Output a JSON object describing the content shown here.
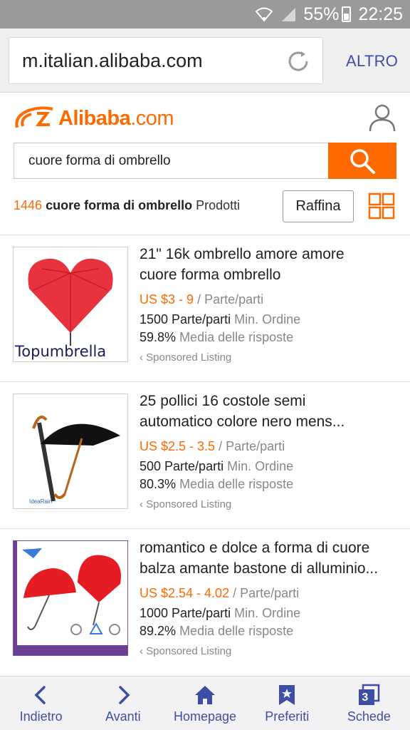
{
  "status_bar": {
    "battery": "55%",
    "time": "22:25"
  },
  "browser": {
    "url": "m.italian.alibaba.com",
    "menu_label": "ALTRO"
  },
  "site": {
    "logo_main": "Alibaba",
    "logo_suffix": ".com",
    "brand_color": "#ff6a00"
  },
  "search": {
    "query": "cuore forma di ombrello"
  },
  "results": {
    "count": "1446",
    "query": "cuore forma di ombrello",
    "suffix": "Prodotti",
    "refine_label": "Raffina"
  },
  "products": [
    {
      "title_line1": "21\" 16k ombrello amore amore",
      "title_line2": "cuore forma ombrello",
      "price": "US $3 - 9",
      "price_unit": "/ Parte/parti",
      "min_qty": "1500 Parte/parti",
      "min_label": "Min. Ordine",
      "rate": "59.8%",
      "rate_label": "Media delle risposte",
      "sponsored": "Sponsored Listing",
      "thumb_caption": "Topumbrella"
    },
    {
      "title_line1": "25 pollici 16 costole semi",
      "title_line2": "automatico colore nero mens...",
      "price": "US $2.5 - 3.5",
      "price_unit": "/ Parte/parti",
      "min_qty": "500 Parte/parti",
      "min_label": "Min. Ordine",
      "rate": "80.3%",
      "rate_label": "Media delle risposte",
      "sponsored": "Sponsored Listing",
      "thumb_caption": "IdeaRain"
    },
    {
      "title_line1": "romantico e dolce a forma di cuore",
      "title_line2": "balza amante bastone di alluminio...",
      "price": "US $2.54 - 4.02",
      "price_unit": "/ Parte/parti",
      "min_qty": "1000 Parte/parti",
      "min_label": "Min. Ordine",
      "rate": "89.2%",
      "rate_label": "Media delle risposte",
      "sponsored": "Sponsored Listing"
    }
  ],
  "bottom_nav": {
    "back": "Indietro",
    "forward": "Avanti",
    "home": "Homepage",
    "bookmarks": "Preferiti",
    "tabs": "Schede",
    "tabs_count": "3"
  }
}
